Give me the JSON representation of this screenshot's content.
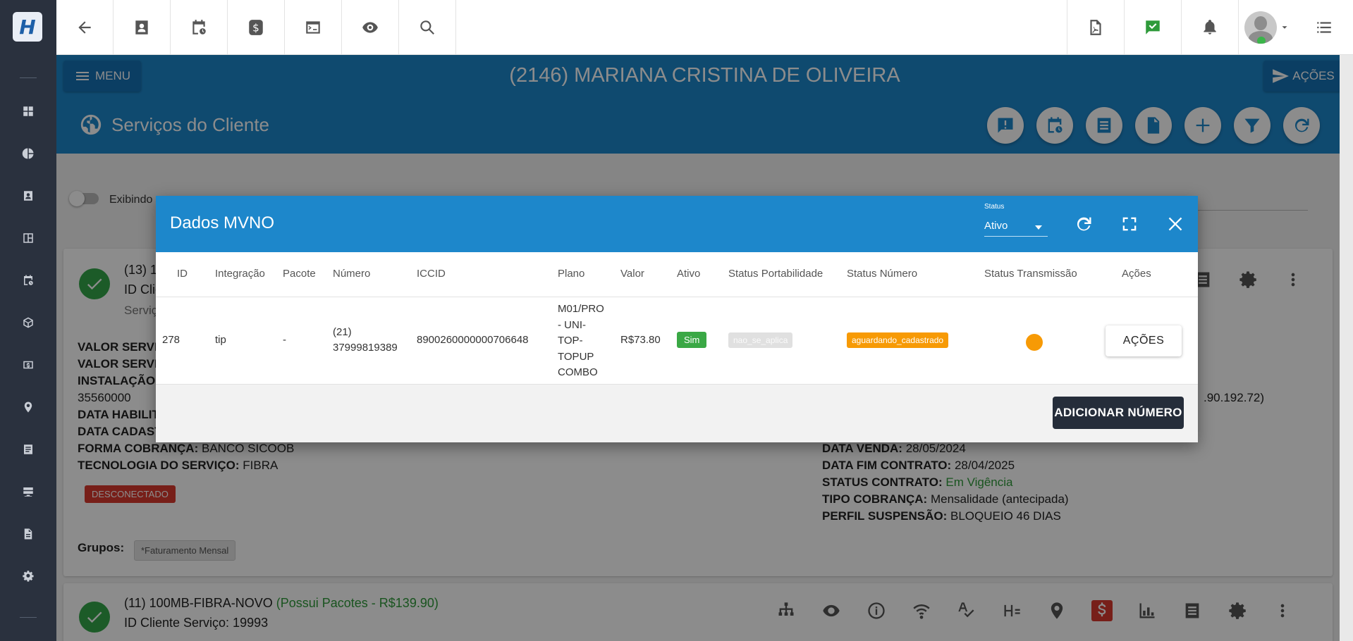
{
  "topbar": {
    "logo_letter": "H",
    "left_icons": [
      "back-arrow-icon",
      "contact-card-icon",
      "calendar-clock-icon",
      "dollar-icon",
      "terminal-icon",
      "eye-icon",
      "search-icon"
    ],
    "right_icons": [
      "pdf-icon",
      "checked-message-icon",
      "bell-icon",
      "avatar",
      "list-menu-icon"
    ]
  },
  "sidebar": {
    "icons": [
      "dashboard-icon",
      "pie-chart-icon",
      "contact-icon",
      "board-icon",
      "calendar-clock-icon",
      "box-icon",
      "money-icon",
      "map-pin-icon",
      "document-list-icon",
      "server-icon",
      "file-icon",
      "gear-icon"
    ]
  },
  "titlebar": {
    "menu_label": "MENU",
    "client_title": "(2146) MARIANA CRISTINA DE OLIVEIRA",
    "actions_label": "AÇÕES"
  },
  "services": {
    "title": "Serviços do Cliente",
    "actions": [
      "alert-message-icon",
      "calendar-clock-icon",
      "list-doc-icon",
      "file-icon",
      "plus-icon",
      "filter-icon",
      "refresh-icon"
    ]
  },
  "background": {
    "toggle_label": "Exibindo",
    "card1": {
      "heading_partial": "(13) 1",
      "id_partial": "ID Clie",
      "sub_partial": "Serviç",
      "left_lines": [
        {
          "label": "VALOR SERVIC",
          "value": ""
        },
        {
          "label": "VALOR SERVIC",
          "value": ""
        },
        {
          "label": "INSTALAÇÃO:",
          "value": ""
        },
        {
          "label": "",
          "value": "35560000"
        },
        {
          "label": "DATA HABILIT",
          "value": ""
        },
        {
          "label": "DATA CADAST",
          "value": ""
        },
        {
          "label": "FORMA COBRANÇA:",
          "value": "BANCO SICOOB"
        },
        {
          "label": "TECNOLOGIA DO SERVIÇO:",
          "value": "FIBRA"
        }
      ],
      "status_badge": "DESCONECTADO",
      "groups_label": "Grupos:",
      "group_tag": "*Faturamento Mensal",
      "ip_partial": ".90.192.72)",
      "right_lines": [
        {
          "label": "DATA VENDA:",
          "value": "28/05/2024"
        },
        {
          "label": "DATA FIM CONTRATO:",
          "value": "28/04/2025"
        },
        {
          "label": "STATUS CONTRATO:",
          "value": "Em Vigência"
        },
        {
          "label": "TIPO COBRANÇA:",
          "value": "Mensalidade (antecipada)"
        },
        {
          "label": "PERFIL SUSPENSÃO:",
          "value": "BLOQUEIO 46 DIAS"
        }
      ]
    },
    "card2": {
      "heading": "(11) 100MB-FIBRA-NOVO",
      "heading_extra": "(Possui Pacotes - R$139.90)",
      "id_line": "ID Cliente Serviço: 19993"
    }
  },
  "modal": {
    "title": "Dados MVNO",
    "status_label": "Status",
    "status_value": "Ativo",
    "columns": [
      "ID",
      "Integração",
      "Pacote",
      "Número",
      "ICCID",
      "Plano",
      "Valor",
      "Ativo",
      "Status Portabilidade",
      "Status Número",
      "Status Transmissão",
      "Ações"
    ],
    "row": {
      "id": "278",
      "integracao": "tip",
      "pacote": "-",
      "numero_l1": "(21)",
      "numero_l2": "37999819389",
      "iccid": "8900260000000706648",
      "plano_l1": "M01/PRO",
      "plano_l2": "- UNI-",
      "plano_l3": "TOP-",
      "plano_l4": "TOPUP",
      "plano_l5": "COMBO",
      "valor": "R$73.80",
      "ativo": "Sim",
      "status_portabilidade": "nao_se_aplica",
      "status_numero": "aguardando_cadastrado",
      "acoes_label": "AÇÕES"
    },
    "add_button": "ADICIONAR NÚMERO"
  }
}
